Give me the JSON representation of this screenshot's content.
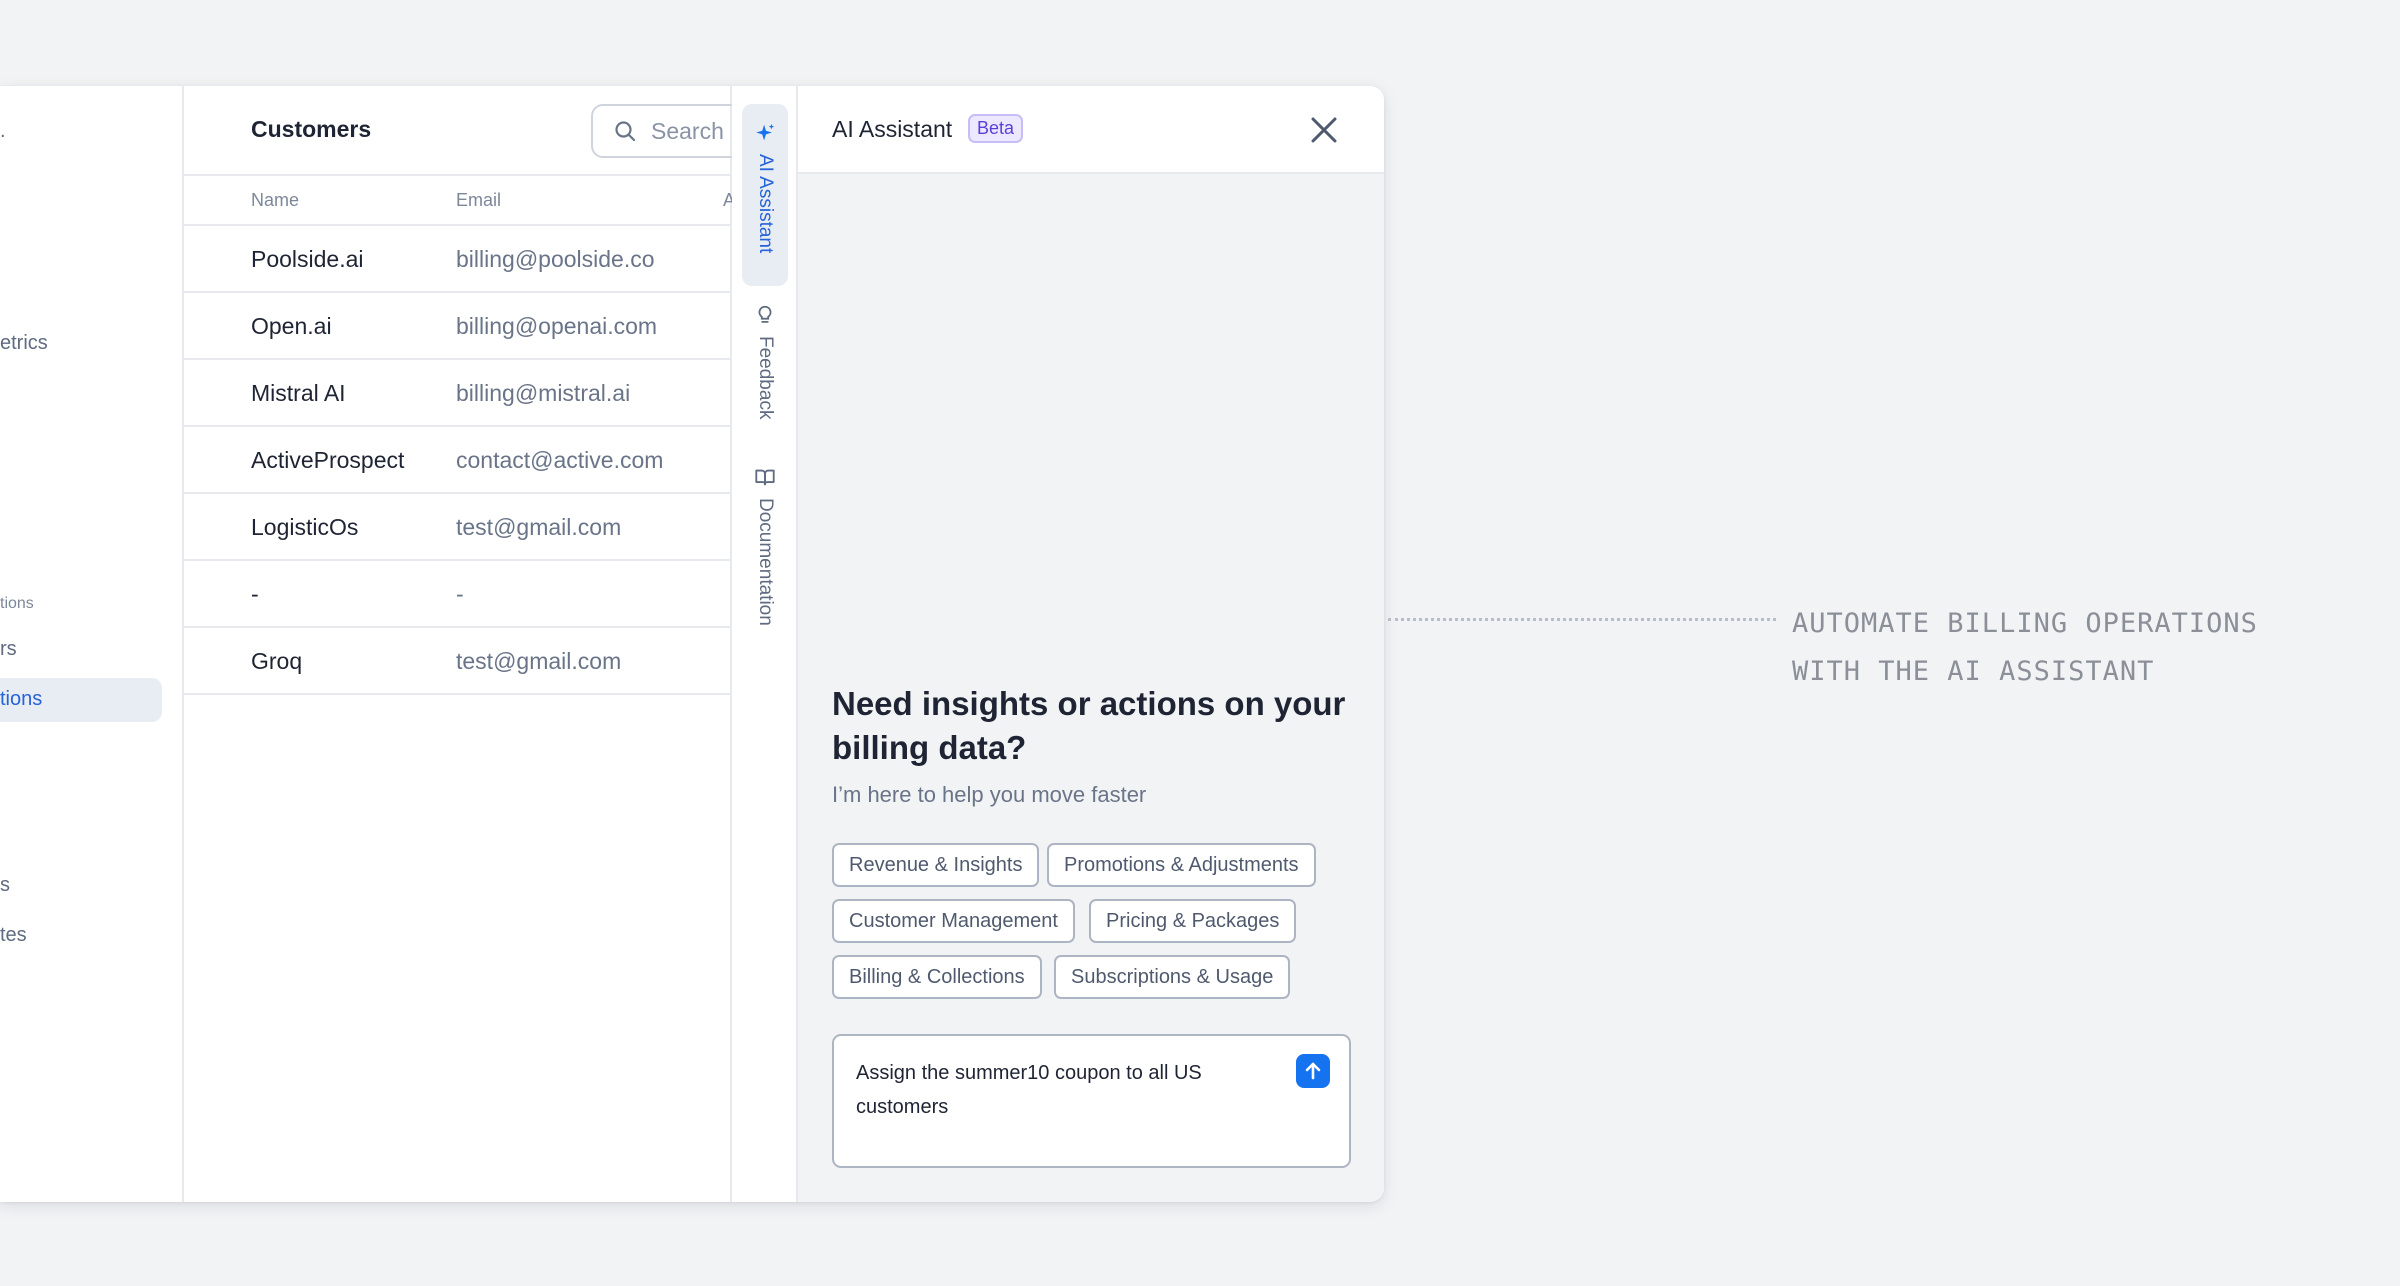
{
  "sidebar": {
    "fragments": [
      ".",
      "etrics",
      "tions",
      "rs",
      "tions",
      "s",
      "tes",
      "rs"
    ]
  },
  "customers": {
    "title": "Customers",
    "search_placeholder": "Search",
    "columns": [
      "Name",
      "Email",
      "A"
    ],
    "rows": [
      {
        "name": "Poolside.ai",
        "email": "billing@poolside.co"
      },
      {
        "name": "Open.ai",
        "email": "billing@openai.com"
      },
      {
        "name": "Mistral AI",
        "email": "billing@mistral.ai"
      },
      {
        "name": "ActiveProspect",
        "email": "contact@active.com"
      },
      {
        "name": "LogisticOs",
        "email": "test@gmail.com"
      },
      {
        "name": "-",
        "email": "-"
      },
      {
        "name": "Groq",
        "email": "test@gmail.com"
      }
    ]
  },
  "strip": {
    "tabs": [
      {
        "label": "AI Assistant",
        "icon": "sparkle-icon"
      },
      {
        "label": "Feedback",
        "icon": "lightbulb-icon"
      },
      {
        "label": "Documentation",
        "icon": "book-icon"
      }
    ]
  },
  "assistant": {
    "title": "AI Assistant",
    "badge": "Beta",
    "heading": "Need insights or actions on your billing data?",
    "subheading": "I’m here to help you move faster",
    "chips": [
      "Revenue & Insights",
      "Promotions & Adjustments",
      "Customer Management",
      "Pricing & Packages",
      "Billing & Collections",
      "Subscriptions & Usage"
    ],
    "input_value": "Assign the summer10 coupon to all US customers"
  },
  "callout": {
    "line1": "AUTOMATE BILLING OPERATIONS",
    "line2": "WITH THE AI ASSISTANT"
  },
  "colors": {
    "accent": "#1673f0",
    "active_text": "#2563d8",
    "badge": "#5b3fd9",
    "background": "#f2f3f5"
  }
}
